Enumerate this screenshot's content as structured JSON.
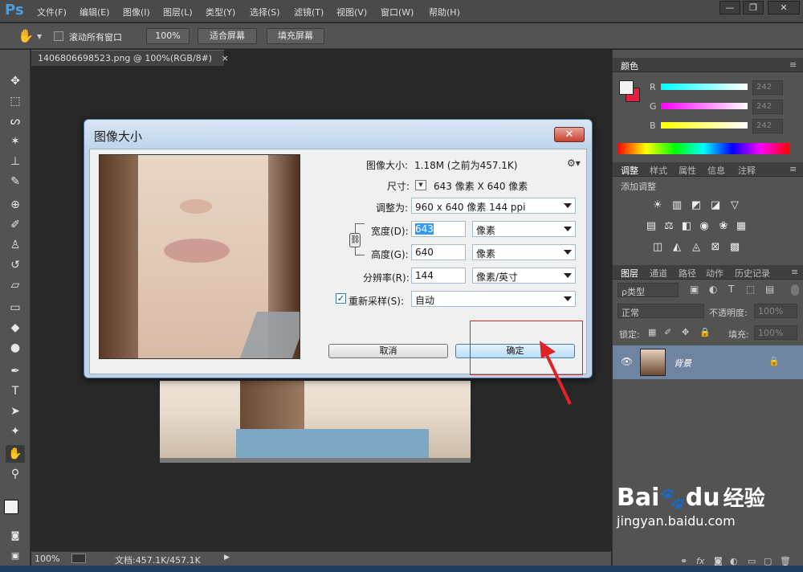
{
  "app": {
    "logo": "Ps",
    "menu": [
      "文件(F)",
      "编辑(E)",
      "图像(I)",
      "图层(L)",
      "类型(Y)",
      "选择(S)",
      "滤镜(T)",
      "视图(V)",
      "窗口(W)",
      "帮助(H)"
    ],
    "window_buttons": [
      "—",
      "❐",
      "✕"
    ]
  },
  "options_bar": {
    "scroll_all_label": "滚动所有窗口",
    "zoom_100_label": "100%",
    "fit_screen_label": "适合屏幕",
    "fill_screen_label": "填充屏幕"
  },
  "document": {
    "tab_title": "1406806698523.png @ 100%(RGB/8#)",
    "tab_close": "×"
  },
  "status_bar": {
    "zoom": "100%",
    "doc_info": "文档:457.1K/457.1K"
  },
  "color_panel": {
    "title": "颜色",
    "channels": [
      {
        "label": "R",
        "value": "242",
        "color": "#00ffff"
      },
      {
        "label": "G",
        "value": "242",
        "color": "#ff00ff"
      },
      {
        "label": "B",
        "value": "242",
        "color": "#ffff00"
      }
    ]
  },
  "adjust_panel": {
    "tabs": [
      "调整",
      "样式",
      "属性",
      "信息",
      "注释"
    ],
    "add_label": "添加调整"
  },
  "layers_panel": {
    "tabs": [
      "图层",
      "通道",
      "路径",
      "动作",
      "历史记录"
    ],
    "filter_label": "ρ类型",
    "blend_mode": "正常",
    "opacity_label": "不透明度:",
    "opacity_value": "100%",
    "lock_label": "锁定:",
    "fill_label": "填充:",
    "fill_value": "100%",
    "layer_name": "背景"
  },
  "dialog": {
    "title": "图像大小",
    "close": "✕",
    "image_size_label": "图像大小:",
    "image_size_value": "1.18M (之前为457.1K)",
    "dimensions_label": "尺寸:",
    "dimensions_value": "643 像素  X  640 像素",
    "fit_to_label": "调整为:",
    "fit_to_value": "960 x 640 像素 144 ppi",
    "width_label": "宽度(D):",
    "width_value": "643",
    "width_unit": "像素",
    "height_label": "高度(G):",
    "height_value": "640",
    "height_unit": "像素",
    "resolution_label": "分辨率(R):",
    "resolution_value": "144",
    "resolution_unit": "像素/英寸",
    "resample_label": "重新采样(S):",
    "resample_value": "自动",
    "cancel_label": "取消",
    "ok_label": "确定"
  },
  "watermark": {
    "brand": "Bai",
    "brand2": "du",
    "cn": "经验",
    "url": "jingyan.baidu.com"
  }
}
